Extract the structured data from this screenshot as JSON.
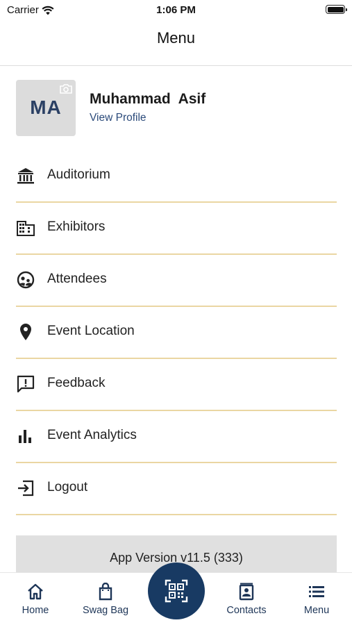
{
  "status_bar": {
    "carrier": "Carrier",
    "time": "1:06 PM"
  },
  "header": {
    "title": "Menu"
  },
  "profile": {
    "initials": "MA",
    "name": "Muhammad  Asif",
    "link": "View Profile"
  },
  "menu": {
    "items": [
      {
        "label": "Auditorium",
        "icon": "auditorium-icon"
      },
      {
        "label": "Exhibitors",
        "icon": "building-icon"
      },
      {
        "label": "Attendees",
        "icon": "attendees-icon"
      },
      {
        "label": "Event Location",
        "icon": "location-pin-icon"
      },
      {
        "label": "Feedback",
        "icon": "feedback-icon"
      },
      {
        "label": "Event Analytics",
        "icon": "bar-chart-icon"
      },
      {
        "label": "Logout",
        "icon": "logout-icon"
      }
    ]
  },
  "footer": {
    "version": "App Version v11.5 (333)"
  },
  "tab_bar": {
    "home": "Home",
    "swag_bag": "Swag Bag",
    "contacts": "Contacts",
    "menu": "Menu",
    "center_icon": "qr-code-icon"
  },
  "colors": {
    "accent": "#183a63",
    "divider": "#ead6a2",
    "link": "#2b4a7a",
    "avatar_bg": "#dcdcdc"
  }
}
